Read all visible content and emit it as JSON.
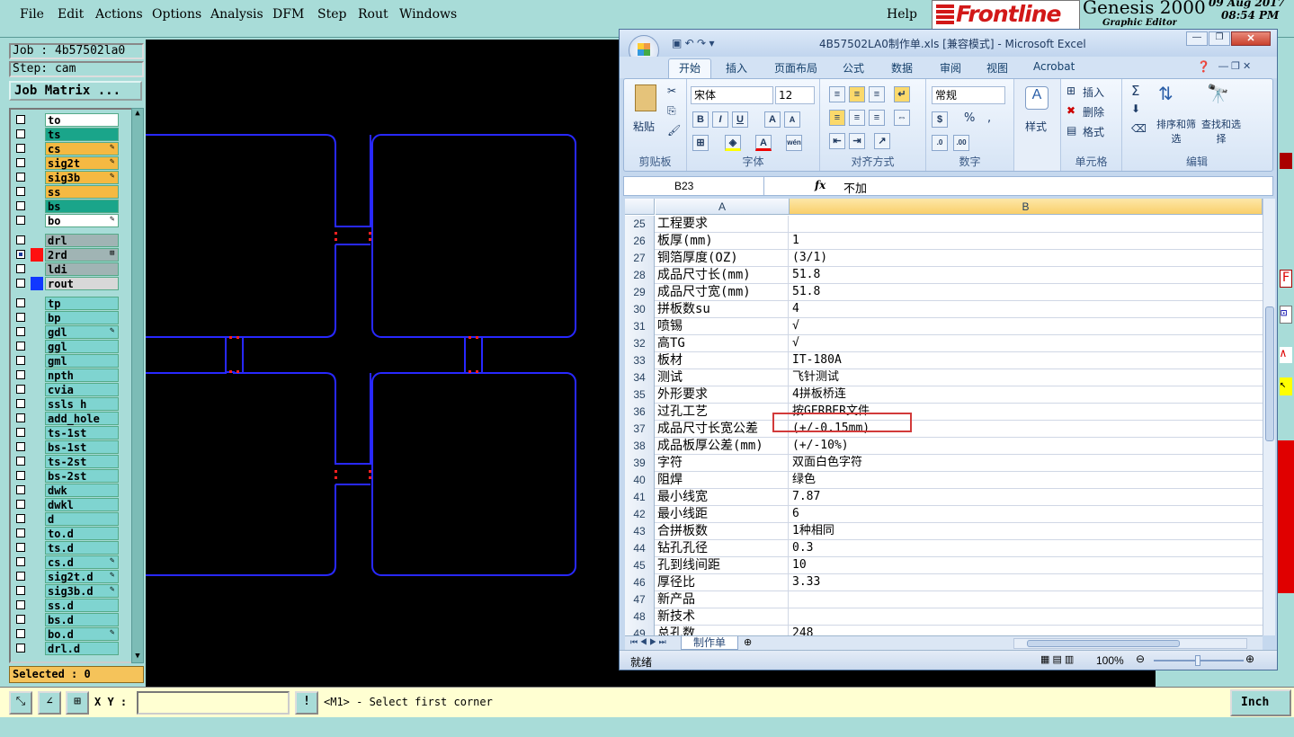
{
  "genesis": {
    "menu": [
      "File",
      "Edit",
      "Actions",
      "Options",
      "Analysis",
      "DFM",
      "Step",
      "Rout",
      "Windows"
    ],
    "help": "Help",
    "logo": "Frontline",
    "product": "Genesis 2000",
    "subtitle": "Graphic Editor",
    "date": "09 Aug 2017",
    "time": "08:54 PM",
    "job": "Job : 4b57502la0",
    "step": "Step: cam",
    "job_matrix": "Job Matrix ...",
    "layers": [
      {
        "name": "to",
        "color": "#ffffff",
        "mark": ""
      },
      {
        "name": "ts",
        "color": "#1aa58a",
        "mark": ""
      },
      {
        "name": "cs",
        "color": "#f5b942",
        "mark": "✎"
      },
      {
        "name": "sig2t",
        "color": "#f5b942",
        "mark": "✎"
      },
      {
        "name": "sig3b",
        "color": "#f5b942",
        "mark": "✎"
      },
      {
        "name": "ss",
        "color": "#f5b942",
        "mark": ""
      },
      {
        "name": "bs",
        "color": "#1aa58a",
        "mark": ""
      },
      {
        "name": "bo",
        "color": "#ffffff",
        "mark": "✎"
      },
      {
        "name": "drl",
        "color": "#a0b4b4",
        "mark": ""
      },
      {
        "name": "2rd",
        "color": "#a0b4b4",
        "mark": "⊞",
        "swatch": "#ff1010",
        "checked": true
      },
      {
        "name": "ldi",
        "color": "#a0b4b4",
        "mark": ""
      },
      {
        "name": "rout",
        "color": "#d8d8d8",
        "mark": "",
        "swatch": "#1038ff"
      },
      {
        "name": "tp",
        "color": "#7fd4d0",
        "mark": ""
      },
      {
        "name": "bp",
        "color": "#7fd4d0",
        "mark": ""
      },
      {
        "name": "gdl",
        "color": "#7fd4d0",
        "mark": "✎"
      },
      {
        "name": "ggl",
        "color": "#7fd4d0",
        "mark": ""
      },
      {
        "name": "gml",
        "color": "#7fd4d0",
        "mark": ""
      },
      {
        "name": "npth",
        "color": "#7fd4d0",
        "mark": ""
      },
      {
        "name": "cvia",
        "color": "#7fd4d0",
        "mark": ""
      },
      {
        "name": "ssls h",
        "color": "#7fd4d0",
        "mark": ""
      },
      {
        "name": "add_hole",
        "color": "#7fd4d0",
        "mark": ""
      },
      {
        "name": "ts-1st",
        "color": "#7fd4d0",
        "mark": ""
      },
      {
        "name": "bs-1st",
        "color": "#7fd4d0",
        "mark": ""
      },
      {
        "name": "ts-2st",
        "color": "#7fd4d0",
        "mark": ""
      },
      {
        "name": "bs-2st",
        "color": "#7fd4d0",
        "mark": ""
      },
      {
        "name": "dwk",
        "color": "#7fd4d0",
        "mark": ""
      },
      {
        "name": "dwkl",
        "color": "#7fd4d0",
        "mark": ""
      },
      {
        "name": "d",
        "color": "#7fd4d0",
        "mark": ""
      },
      {
        "name": "to.d",
        "color": "#7fd4d0",
        "mark": ""
      },
      {
        "name": "ts.d",
        "color": "#7fd4d0",
        "mark": ""
      },
      {
        "name": "cs.d",
        "color": "#7fd4d0",
        "mark": "✎"
      },
      {
        "name": "sig2t.d",
        "color": "#7fd4d0",
        "mark": "✎"
      },
      {
        "name": "sig3b.d",
        "color": "#7fd4d0",
        "mark": "✎"
      },
      {
        "name": "ss.d",
        "color": "#7fd4d0",
        "mark": ""
      },
      {
        "name": "bs.d",
        "color": "#7fd4d0",
        "mark": ""
      },
      {
        "name": "bo.d",
        "color": "#7fd4d0",
        "mark": "✎"
      },
      {
        "name": "drl.d",
        "color": "#7fd4d0",
        "mark": ""
      }
    ],
    "selected": "Selected : 0",
    "xy_label": "X Y :",
    "xy_value": "",
    "prompt": "<M1> - Select first corner",
    "units": "Inch"
  },
  "excel": {
    "title": "4B57502LA0制作单.xls [兼容模式] - Microsoft Excel",
    "tabs": [
      "开始",
      "插入",
      "页面布局",
      "公式",
      "数据",
      "审阅",
      "视图",
      "Acrobat"
    ],
    "clipboard": {
      "paste": "粘贴",
      "label": "剪贴板"
    },
    "font": {
      "name": "宋体",
      "size": "12",
      "label": "字体"
    },
    "align": {
      "label": "对齐方式"
    },
    "number": {
      "format": "常规",
      "label": "数字",
      "pct": "%",
      "comma": ","
    },
    "styles": {
      "label": "样式"
    },
    "cells": {
      "insert": "插入",
      "delete": "删除",
      "format": "格式",
      "label": "单元格"
    },
    "editing": {
      "sort": "排序和筛选",
      "find": "查找和选择",
      "label": "编辑"
    },
    "name_box": "B23",
    "formula": "不加",
    "col_a": "A",
    "col_b": "B",
    "rows": [
      {
        "n": "25",
        "a": "工程要求",
        "b": ""
      },
      {
        "n": "26",
        "a": "板厚(mm)",
        "b": "1"
      },
      {
        "n": "27",
        "a": "铜箔厚度(OZ)",
        "b": "(3/1)"
      },
      {
        "n": "28",
        "a": "成品尺寸长(mm)",
        "b": "51.8"
      },
      {
        "n": "29",
        "a": "成品尺寸宽(mm)",
        "b": "51.8"
      },
      {
        "n": "30",
        "a": "拼板数su",
        "b": "4"
      },
      {
        "n": "31",
        "a": "喷锡",
        "b": "√"
      },
      {
        "n": "32",
        "a": "高TG",
        "b": "√"
      },
      {
        "n": "33",
        "a": "板材",
        "b": "IT-180A"
      },
      {
        "n": "34",
        "a": "测试",
        "b": "飞针测试"
      },
      {
        "n": "35",
        "a": "外形要求",
        "b": "4拼板桥连"
      },
      {
        "n": "36",
        "a": "过孔工艺",
        "b": "按GERBER文件"
      },
      {
        "n": "37",
        "a": "成品尺寸长宽公差",
        "b": "(+/-0.15mm)"
      },
      {
        "n": "38",
        "a": "成品板厚公差(mm)",
        "b": "(+/-10%)"
      },
      {
        "n": "39",
        "a": "字符",
        "b": "双面白色字符"
      },
      {
        "n": "40",
        "a": "阻焊",
        "b": "绿色"
      },
      {
        "n": "41",
        "a": "最小线宽",
        "b": "7.87"
      },
      {
        "n": "42",
        "a": "最小线距",
        "b": "6"
      },
      {
        "n": "43",
        "a": "合拼板数",
        "b": "1种相同"
      },
      {
        "n": "44",
        "a": "钻孔孔径",
        "b": "0.3"
      },
      {
        "n": "45",
        "a": "孔到线间距",
        "b": "10"
      },
      {
        "n": "46",
        "a": "厚径比",
        "b": "3.33"
      },
      {
        "n": "47",
        "a": "新产品",
        "b": ""
      },
      {
        "n": "48",
        "a": "新技术",
        "b": ""
      },
      {
        "n": "49",
        "a": "总孔数",
        "b": "248"
      }
    ],
    "sheet_tab": "制作单",
    "status": "就绪",
    "zoom": "100%"
  }
}
